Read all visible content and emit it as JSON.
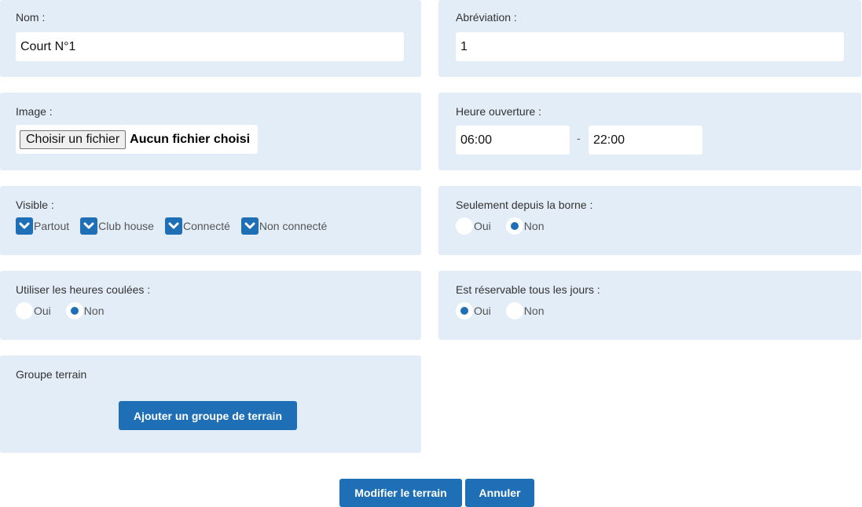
{
  "name": {
    "label": "Nom :",
    "value": "Court N°1"
  },
  "abbreviation": {
    "label": "Abréviation :",
    "value": "1"
  },
  "image": {
    "label": "Image :",
    "button": "Choisir un fichier",
    "status": "Aucun fichier choisi"
  },
  "opening_hours": {
    "label": "Heure ouverture :",
    "start": "06:00",
    "separator": "-",
    "end": "22:00"
  },
  "visible": {
    "label": "Visible :",
    "options": [
      {
        "label": "Partout",
        "checked": true
      },
      {
        "label": "Club house",
        "checked": true
      },
      {
        "label": "Connecté",
        "checked": true
      },
      {
        "label": "Non connecté",
        "checked": true
      }
    ]
  },
  "terminal_only": {
    "label": "Seulement depuis la borne :",
    "yes": "Oui",
    "no": "Non",
    "selected": "no"
  },
  "flowing_hours": {
    "label": "Utiliser les heures coulées :",
    "yes": "Oui",
    "no": "Non",
    "selected": "no"
  },
  "bookable_daily": {
    "label": "Est réservable tous les jours :",
    "yes": "Oui",
    "no": "Non",
    "selected": "yes"
  },
  "court_group": {
    "label": "Groupe terrain",
    "add_button": "Ajouter un groupe de terrain"
  },
  "actions": {
    "submit": "Modifier le terrain",
    "cancel": "Annuler"
  },
  "colors": {
    "panel_bg": "#e3edf7",
    "accent": "#1e6fb5"
  }
}
